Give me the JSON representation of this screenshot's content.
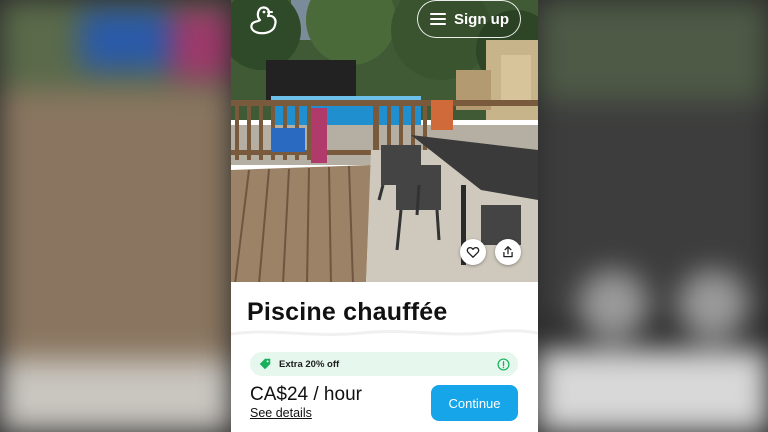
{
  "header": {
    "logo_icon": "duck-logo-icon",
    "menu_icon": "hamburger-menu-icon",
    "signup_label": "Sign up"
  },
  "photo": {
    "favorite_icon": "heart-icon",
    "share_icon": "share-icon"
  },
  "listing": {
    "title": "Piscine chauffée",
    "promo_text": "Extra 20% off",
    "promo_icon": "tag-icon",
    "info_icon": "info-icon",
    "price": "CA$24 / hour",
    "details_link": "See details",
    "continue_label": "Continue"
  },
  "colors": {
    "accent": "#16a5e8",
    "promo_bg": "#e6f7ee",
    "promo_icon": "#16b05c"
  }
}
